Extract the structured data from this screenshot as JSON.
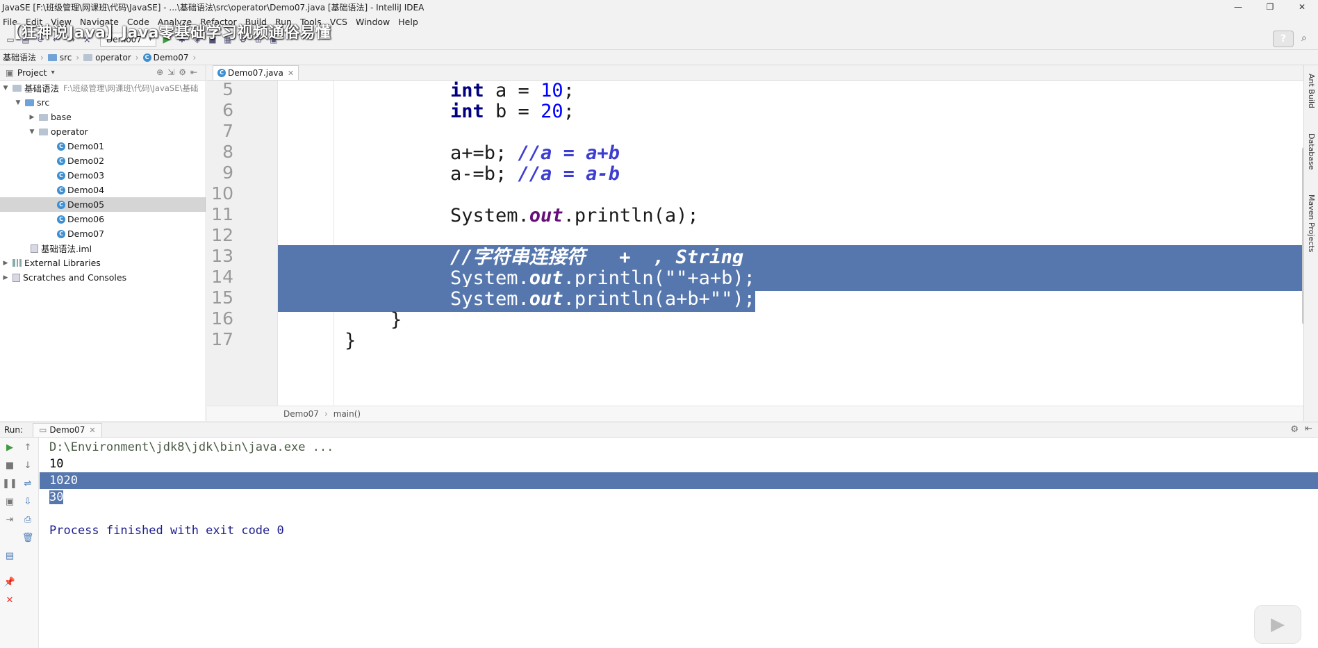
{
  "window": {
    "title": "JavaSE [F:\\班级管理\\网课班\\代码\\JavaSE] - ...\\基础语法\\src\\operator\\Demo07.java [基础语法] - IntelliJ IDEA",
    "overlay_title": "【狂神说Java】Java零基础学习视频通俗易懂"
  },
  "menu": [
    "File",
    "Edit",
    "View",
    "Navigate",
    "Code",
    "Analyze",
    "Refactor",
    "Build",
    "Run",
    "Tools",
    "VCS",
    "Window",
    "Help"
  ],
  "toolbar": {
    "run_config": "Demo07",
    "help": "?"
  },
  "breadcrumb": [
    "基础语法",
    "src",
    "operator",
    "Demo07"
  ],
  "project": {
    "header": "Project",
    "root": {
      "name": "基础语法",
      "path": "F:\\班级管理\\网课班\\代码\\JavaSE\\基础"
    },
    "src": "src",
    "base": "base",
    "operator": "operator",
    "classes": [
      "Demo01",
      "Demo02",
      "Demo03",
      "Demo04",
      "Demo05",
      "Demo06",
      "Demo07"
    ],
    "selected_class": "Demo05",
    "iml": "基础语法.iml",
    "external": "External Libraries",
    "scratches": "Scratches and Consoles"
  },
  "editor": {
    "tab": "Demo07.java",
    "line_numbers": [
      "5",
      "6",
      "7",
      "8",
      "9",
      "10",
      "11",
      "12",
      "13",
      "14",
      "15",
      "16",
      "17"
    ],
    "code": {
      "l5_kw": "int",
      "l5_rest": " a = ",
      "l5_num": "10",
      "l5_end": ";",
      "l6_kw": "int",
      "l6_rest": " b = ",
      "l6_num": "20",
      "l6_end": ";",
      "l8_code": "a+=b; ",
      "l8_cmt": "//a = a+b",
      "l9_code": "a-=b; ",
      "l9_cmt": "//a = a-b",
      "l11_a": "System.",
      "l11_fld": "out",
      "l11_b": ".println(a);",
      "l13_cmt": "//字符串连接符   +  , String",
      "l14_a": "System.",
      "l14_fld": "out",
      "l14_b": ".println(\"\"+a+b);",
      "l15_a": "System.",
      "l15_fld": "out",
      "l15_b": ".println(a+b+\"\");",
      "l16": "}",
      "l17": "}"
    },
    "crumb": [
      "Demo07",
      "main()"
    ]
  },
  "right_strip": [
    "Ant Build",
    "Database",
    "Maven Projects"
  ],
  "run": {
    "label": "Run:",
    "tab": "Demo07",
    "lines": {
      "cmd": "D:\\Environment\\jdk8\\jdk\\bin\\java.exe ...",
      "out1": "10",
      "out2": "1020",
      "out3": "30",
      "exit": "Process finished with exit code 0"
    }
  }
}
